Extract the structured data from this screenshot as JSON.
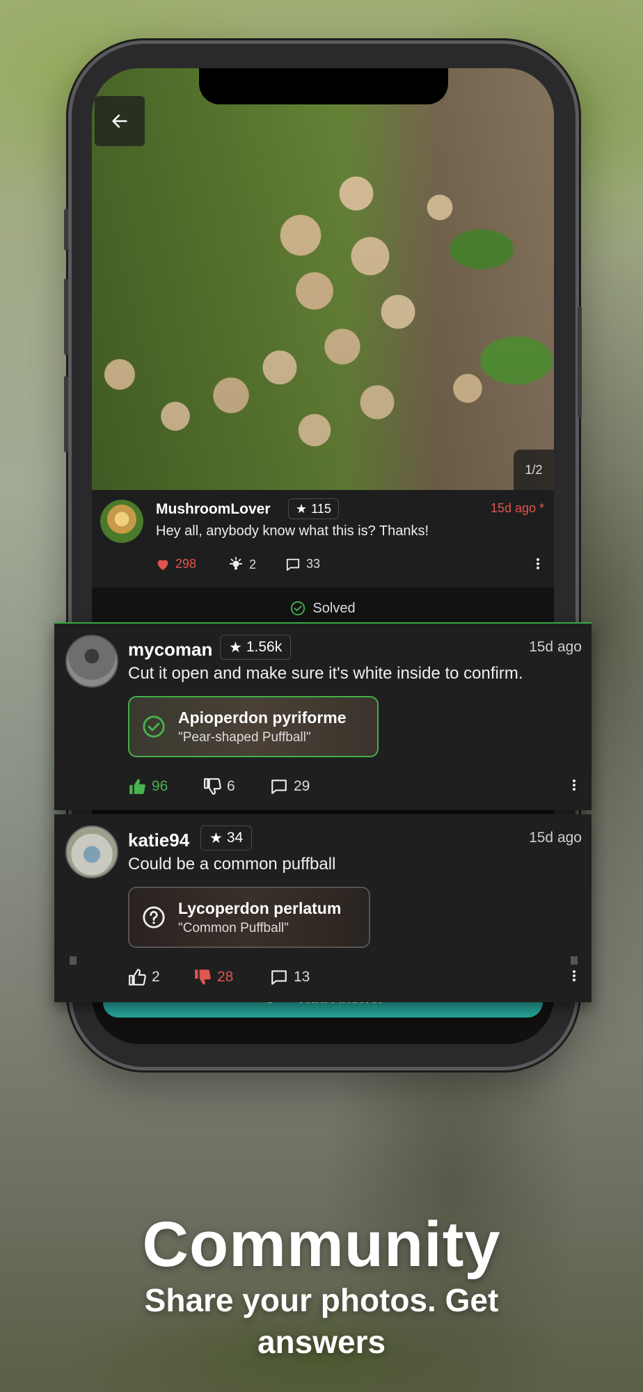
{
  "post": {
    "counter": "1/2",
    "username": "MushroomLover",
    "rating": "115",
    "time": "15d ago *",
    "text": "Hey all, anybody know what this is? Thanks!",
    "likes": "298",
    "ideas": "2",
    "comments": "33"
  },
  "solved_label": "Solved",
  "answers": [
    {
      "username": "mycoman",
      "rating": "1.56k",
      "time": "15d ago",
      "text": "Cut it open and make sure it's white inside to confirm.",
      "species": "Apioperdon pyriforme",
      "common": "\"Pear-shaped Puffball\"",
      "upvotes": "96",
      "downvotes": "6",
      "comments": "29"
    },
    {
      "username": "katie94",
      "rating": "34",
      "time": "15d ago",
      "text": "Could be a common puffball",
      "species": "Lycoperdon perlatum",
      "common": "\"Common Puffball\"",
      "upvotes": "2",
      "downvotes": "28",
      "comments": "13"
    }
  ],
  "add_answer": "Add Answer",
  "caption": {
    "title": "Community",
    "subtitle": "Share your photos. Get answers"
  },
  "colors": {
    "accent_green": "#49b34f",
    "accent_red": "#e0554f",
    "teal": "#26a69a"
  },
  "icons": [
    "arrow-left-icon",
    "heart-icon",
    "lightbulb-icon",
    "comment-icon",
    "more-icon",
    "check-circle-icon",
    "thumbs-up-icon",
    "thumbs-down-icon",
    "question-circle-icon",
    "star-icon"
  ]
}
